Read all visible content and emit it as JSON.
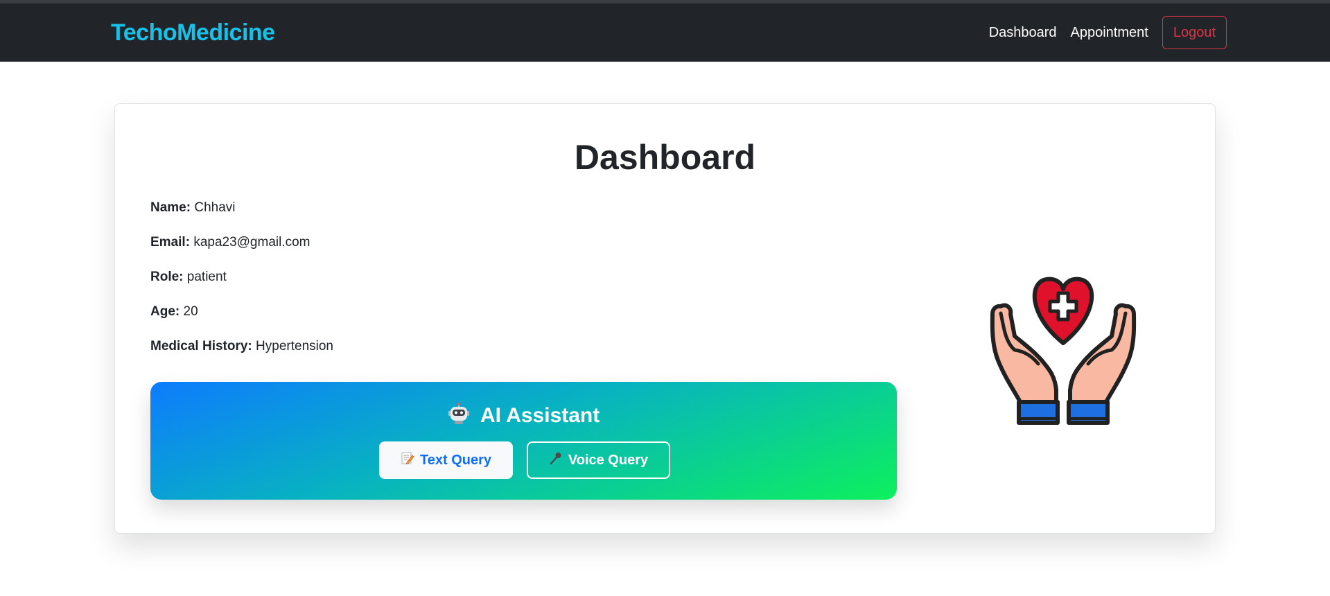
{
  "navbar": {
    "brand": "TechoMedicine",
    "links": [
      "Dashboard",
      "Appointment"
    ],
    "logout_label": "Logout",
    "brand_color": "#17c1e8",
    "logout_color": "#dc3545"
  },
  "dashboard": {
    "title": "Dashboard",
    "fields": [
      {
        "label": "Name:",
        "value": "Chhavi"
      },
      {
        "label": "Email:",
        "value": "kapa23@gmail.com"
      },
      {
        "label": "Role:",
        "value": "patient"
      },
      {
        "label": "Age:",
        "value": "20"
      },
      {
        "label": "Medical History:",
        "value": "Hypertension"
      }
    ]
  },
  "assistant": {
    "title": "AI Assistant",
    "title_icon": "robot-icon",
    "text_query_label": "Text Query",
    "text_query_icon": "memo-icon",
    "voice_query_label": "Voice Query",
    "voice_query_icon": "microphone-icon",
    "gradient_start": "#0d7cfd",
    "gradient_end": "#0df05d"
  },
  "illustration": {
    "icon": "hands-holding-heart-icon",
    "heart_color": "#e0112b",
    "skin_color": "#f9b8a2",
    "cuff_color": "#1e6fe0"
  }
}
